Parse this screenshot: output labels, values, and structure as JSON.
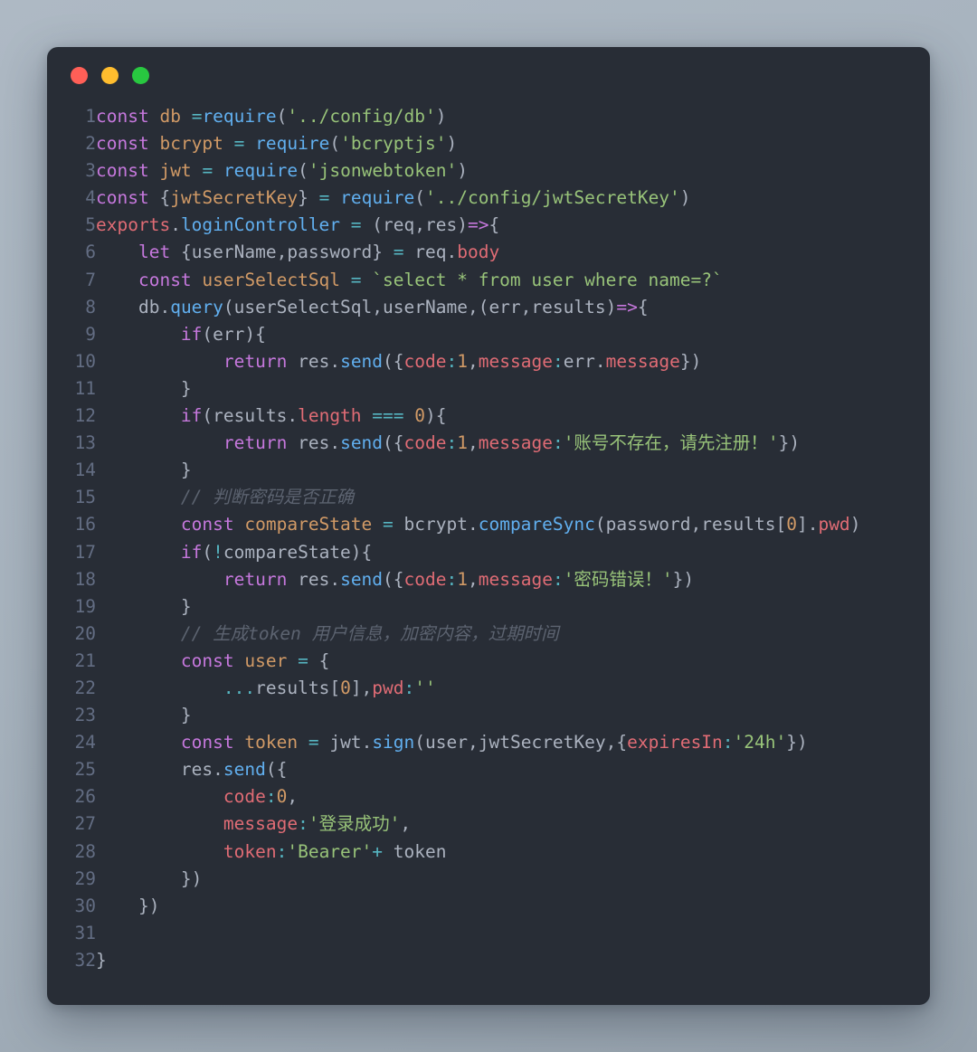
{
  "window": {
    "controls": [
      {
        "name": "close",
        "color": "#ff5f57"
      },
      {
        "name": "minimize",
        "color": "#ffbd2e"
      },
      {
        "name": "maximize",
        "color": "#28c840"
      }
    ]
  },
  "editor": {
    "language": "javascript",
    "theme": "one-dark",
    "background": "#282d36",
    "page_background": "#a8b4bf",
    "line_count": 32,
    "line_numbers": [
      1,
      2,
      3,
      4,
      5,
      6,
      7,
      8,
      9,
      10,
      11,
      12,
      13,
      14,
      15,
      16,
      17,
      18,
      19,
      20,
      21,
      22,
      23,
      24,
      25,
      26,
      27,
      28,
      29,
      30,
      31,
      32
    ],
    "lines": [
      "const db =require('../config/db')",
      "const bcrypt = require('bcryptjs')",
      "const jwt = require('jsonwebtoken')",
      "const {jwtSecretKey} = require('../config/jwtSecretKey')",
      "exports.loginController = (req,res)=>{",
      "    let {userName,password} = req.body",
      "    const userSelectSql = `select * from user where name=?`",
      "    db.query(userSelectSql,userName,(err,results)=>{",
      "        if(err){",
      "            return res.send({code:1,message:err.message})",
      "        }",
      "        if(results.length === 0){",
      "            return res.send({code:1,message:'账号不存在，请先注册！'})",
      "        }",
      "        // 判断密码是否正确",
      "        const compareState = bcrypt.compareSync(password,results[0].pwd)",
      "        if(!compareState){",
      "            return res.send({code:1,message:'密码错误！'})",
      "        }",
      "        // 生成token 用户信息，加密内容，过期时间",
      "        const user = {",
      "            ...results[0],pwd:''",
      "        }",
      "        const token = jwt.sign(user,jwtSecretKey,{expiresIn:'24h'})",
      "        res.send({",
      "            code:0,",
      "            message:'登录成功',",
      "            token:'Bearer'+ token",
      "        })",
      "    })",
      "",
      "}"
    ],
    "strings": [
      "'../config/db'",
      "'bcryptjs'",
      "'jsonwebtoken'",
      "'../config/jwtSecretKey'",
      "`select * from user where name=?`",
      "'账号不存在，请先注册！'",
      "'密码错误！'",
      "''",
      "'24h'",
      "'登录成功'",
      "'Bearer'"
    ],
    "comments": [
      "// 判断密码是否正确",
      "// 生成token 用户信息，加密内容，过期时间"
    ],
    "identifiers": [
      "db",
      "bcrypt",
      "jwt",
      "jwtSecretKey",
      "exports",
      "loginController",
      "req",
      "res",
      "userName",
      "password",
      "userSelectSql",
      "query",
      "err",
      "results",
      "send",
      "code",
      "message",
      "length",
      "compareState",
      "compareSync",
      "pwd",
      "user",
      "token",
      "sign",
      "expiresIn",
      "body",
      "require"
    ],
    "keywords": [
      "const",
      "let",
      "if",
      "return",
      "=>"
    ],
    "numbers": [
      "1",
      "0",
      "0"
    ],
    "colors": {
      "keyword": "#c678dd",
      "function": "#61afef",
      "string": "#98c379",
      "number": "#d19a66",
      "variable": "#d19a66",
      "property": "#e06c75",
      "operator": "#56b6c2",
      "plain": "#abb2bf",
      "comment": "#5c6370",
      "line_number": "#636d83"
    }
  }
}
